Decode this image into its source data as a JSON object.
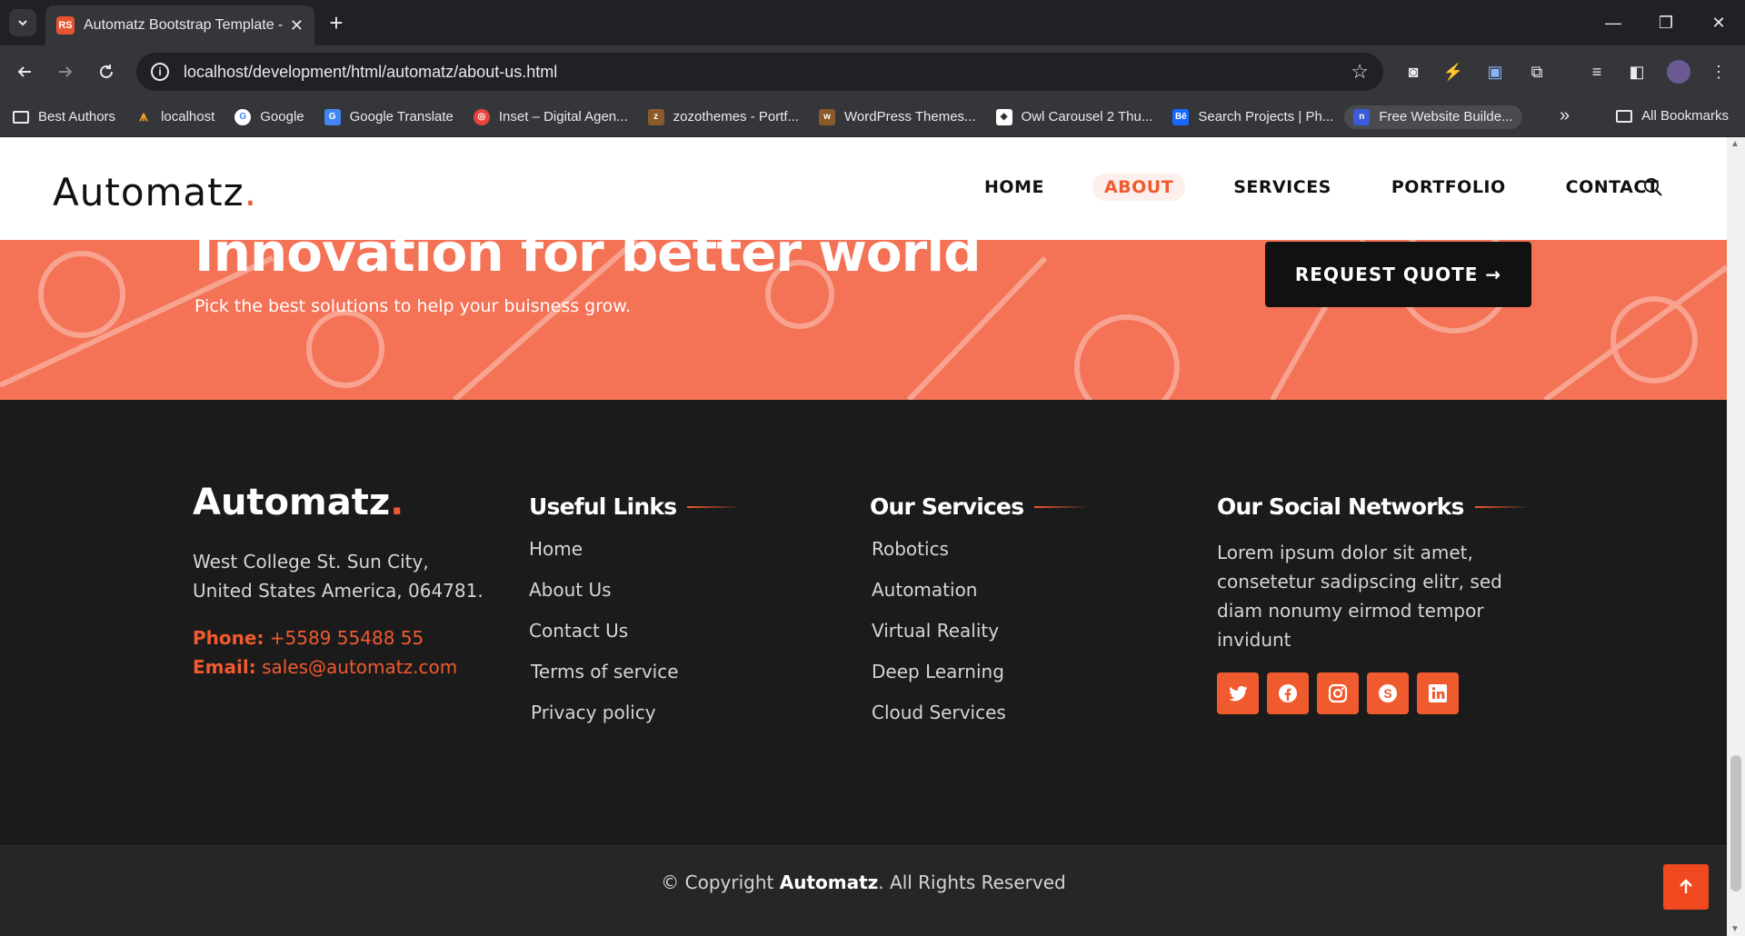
{
  "browser": {
    "tab_title": "Automatz Bootstrap Template -",
    "url": "localhost/development/html/automatz/about-us.html",
    "bookmarks": [
      {
        "label": "Best Authors"
      },
      {
        "label": "localhost"
      },
      {
        "label": "Google"
      },
      {
        "label": "Google Translate"
      },
      {
        "label": "Inset – Digital Agen..."
      },
      {
        "label": "zozothemes - Portf..."
      },
      {
        "label": "WordPress Themes..."
      },
      {
        "label": "Owl Carousel 2 Thu..."
      },
      {
        "label": "Search Projects | Ph..."
      },
      {
        "label": "Free Website Builde..."
      }
    ],
    "all_bookmarks": "All Bookmarks"
  },
  "site": {
    "logo": "Automatz",
    "logo_dot": ".",
    "nav": [
      {
        "label": "HOME",
        "active": false
      },
      {
        "label": "ABOUT",
        "active": true
      },
      {
        "label": "SERVICES",
        "active": false
      },
      {
        "label": "PORTFOLIO",
        "active": false
      },
      {
        "label": "CONTACT",
        "active": false
      }
    ]
  },
  "hero": {
    "title": "Innovation for better world",
    "subtitle": "Pick the best solutions to help your buisness grow.",
    "cta": "REQUEST QUOTE →"
  },
  "footer": {
    "logo": "Automatz",
    "logo_dot": ".",
    "address": "West College St. Sun City, United States America, 064781.",
    "phone_label": "Phone:",
    "phone": "+5589 55488 55",
    "email_label": "Email:",
    "email": "sales@automatz.com",
    "useful_links_title": "Useful Links",
    "useful_links": [
      "Home",
      "About Us",
      "Contact Us",
      "Terms of service",
      "Privacy policy"
    ],
    "services_title": "Our Services",
    "services": [
      "Robotics",
      "Automation",
      "Virtual Reality",
      "Deep Learning",
      "Cloud Services"
    ],
    "social_title": "Our Social Networks",
    "social_text": "Lorem ipsum dolor sit amet, consetetur sadipscing elitr, sed diam nonumy eirmod tempor invidunt",
    "social_icons": [
      "twitter-icon",
      "facebook-icon",
      "instagram-icon",
      "skype-icon",
      "linkedin-icon"
    ]
  },
  "bottom": {
    "copyright_prefix": "© Copyright",
    "copyright_brand": "Automatz",
    "copyright_suffix": ". All Rights Reserved"
  },
  "colors": {
    "accent": "#f05a2f",
    "hero_bg": "#f47255",
    "footer_bg": "#1b1b1b"
  }
}
